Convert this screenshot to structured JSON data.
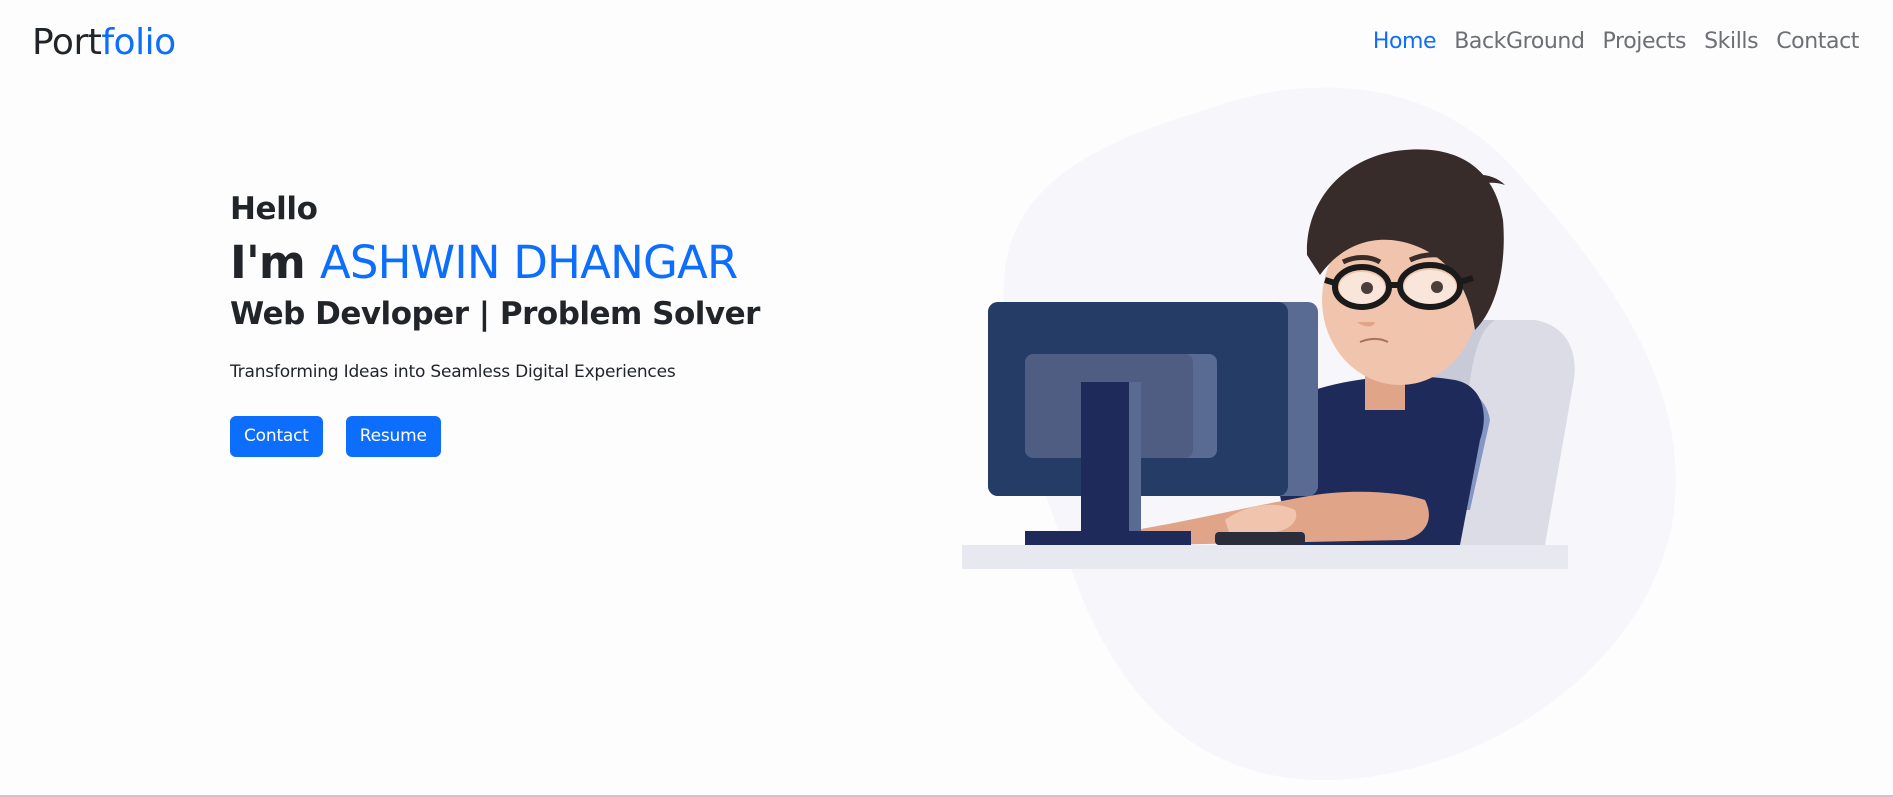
{
  "brand": {
    "prefix": "Port",
    "suffix": "folio"
  },
  "nav": {
    "items": [
      {
        "label": "Home",
        "active": true
      },
      {
        "label": "BackGround",
        "active": false
      },
      {
        "label": "Projects",
        "active": false
      },
      {
        "label": "Skills",
        "active": false
      },
      {
        "label": "Contact",
        "active": false
      }
    ]
  },
  "hero": {
    "greeting": "Hello",
    "intro": "I'm",
    "name": "ASHWIN DHANGAR",
    "role": "Web Devloper | Problem Solver",
    "tagline": "Transforming Ideas into Seamless Digital Experiences",
    "buttons": {
      "contact": "Contact",
      "resume": "Resume"
    }
  },
  "colors": {
    "accent": "#0d6efd",
    "text": "#212529",
    "nav_text": "#6c6f73",
    "blob": "#f6f6fb"
  },
  "icons": {
    "illustration": "developer-at-computer-illustration"
  }
}
